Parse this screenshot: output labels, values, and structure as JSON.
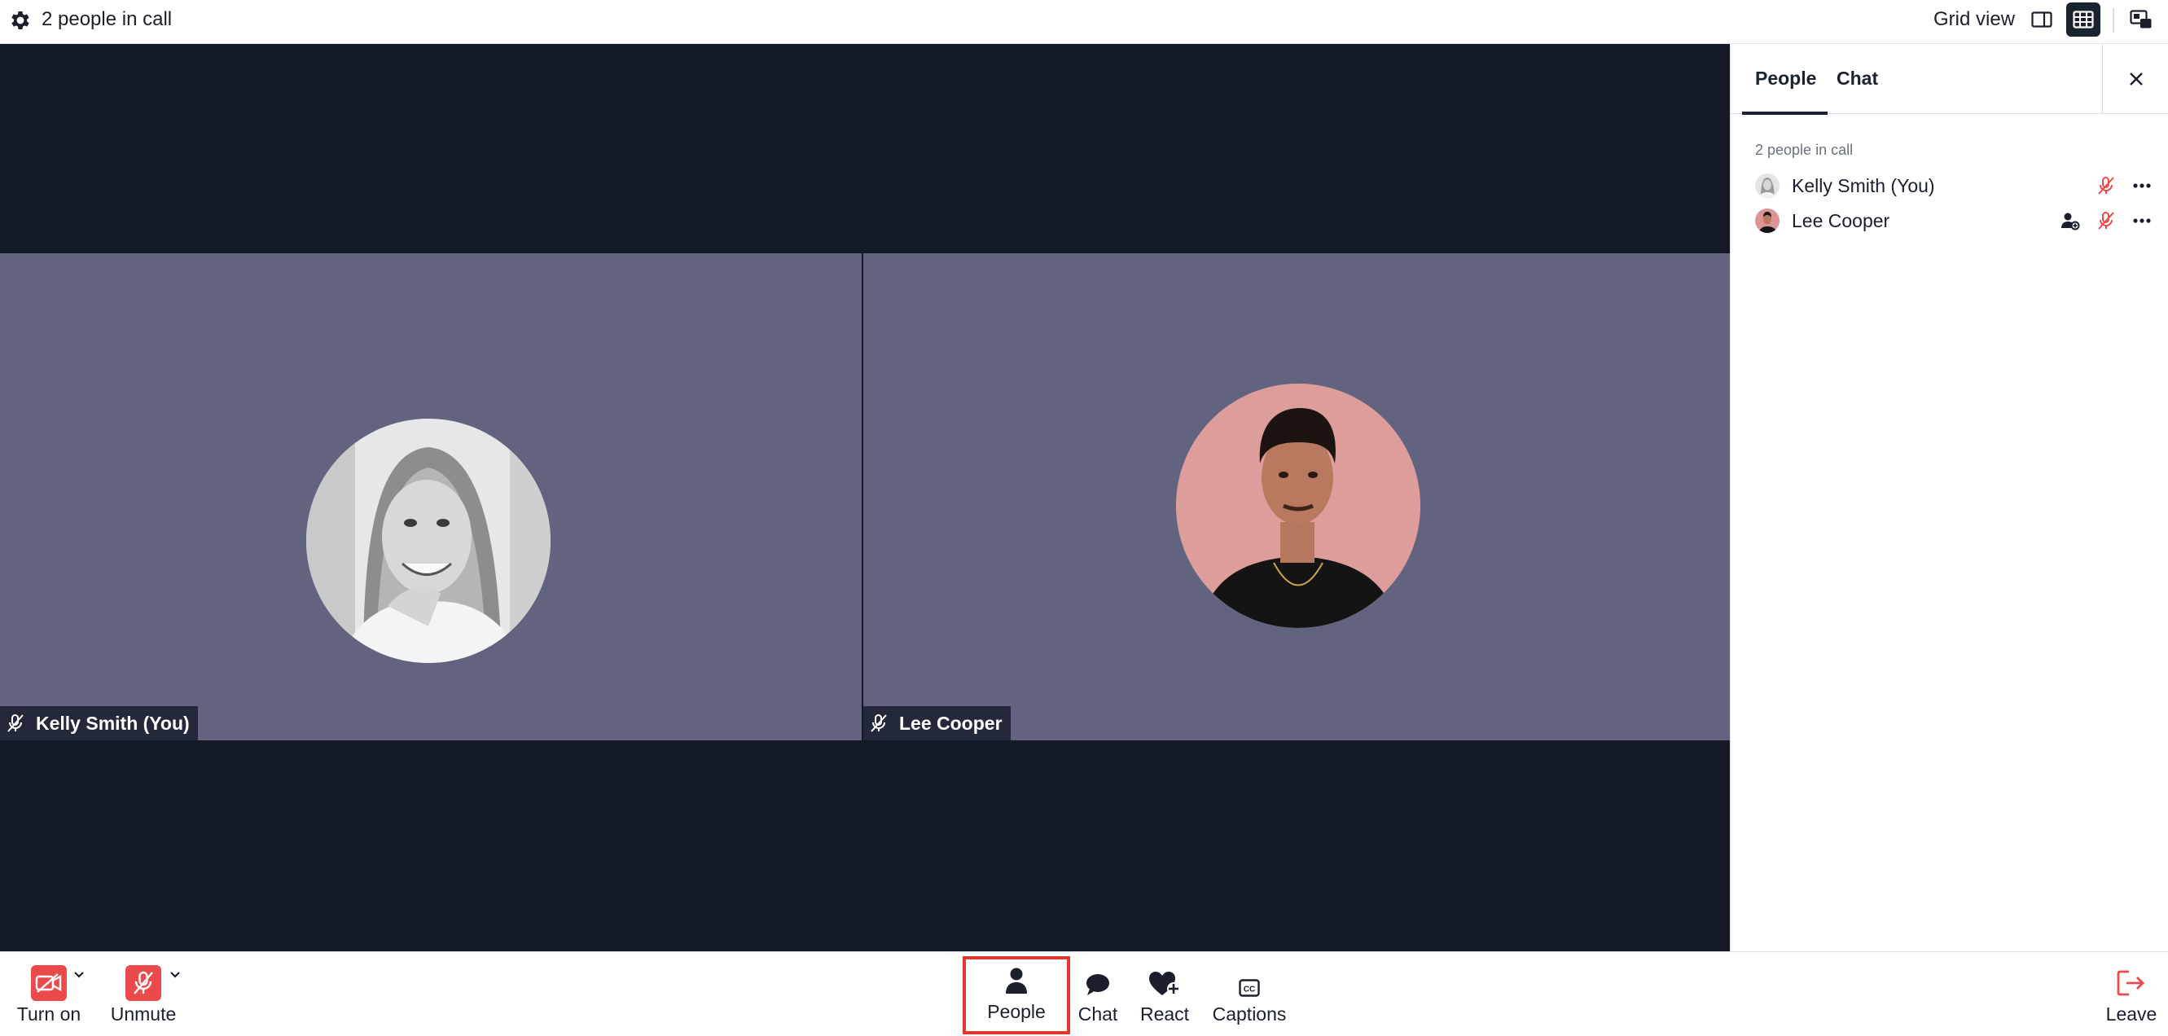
{
  "topbar": {
    "title": "2 people in call",
    "view_label": "Grid view",
    "icons": [
      "gear-icon",
      "sidebar-layout-icon",
      "grid-layout-icon",
      "picture-in-picture-icon"
    ]
  },
  "stage": {
    "tiles": [
      {
        "name": "Kelly Smith (You)",
        "muted": true,
        "avatar_style": "grayscale"
      },
      {
        "name": "Lee Cooper",
        "muted": true,
        "avatar_style": "pink-background"
      }
    ]
  },
  "panel": {
    "tabs": [
      {
        "label": "People",
        "active": true
      },
      {
        "label": "Chat",
        "active": false
      }
    ],
    "count_label": "2 people in call",
    "participants": [
      {
        "name": "Kelly Smith (You)",
        "muted": true
      },
      {
        "name": "Lee Cooper",
        "muted": true,
        "has_promote_icon": true
      }
    ]
  },
  "toolbar": {
    "camera_label": "Turn on",
    "mic_label": "Unmute",
    "people_label": "People",
    "chat_label": "Chat",
    "react_label": "React",
    "captions_label": "Captions",
    "leave_label": "Leave",
    "colors": {
      "danger": "#ea4a4a",
      "highlight": "#e0372f",
      "stage": "#141a25",
      "tile": "#62647f"
    }
  }
}
